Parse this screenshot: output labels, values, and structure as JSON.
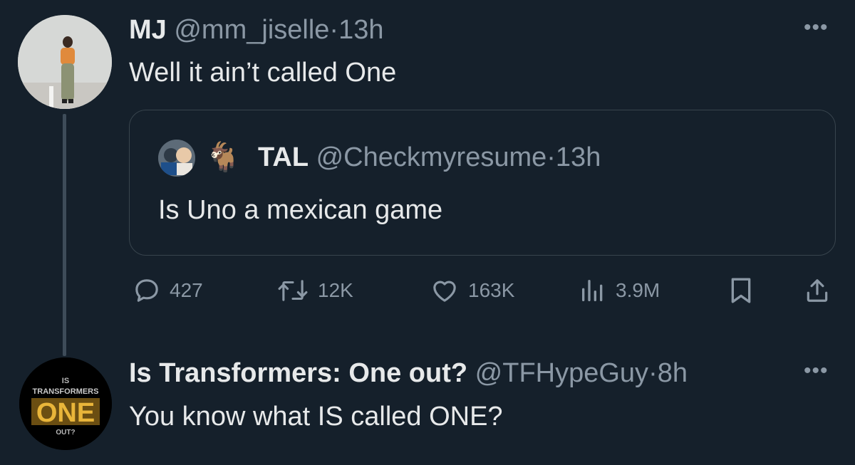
{
  "tweet1": {
    "name": "MJ",
    "handle": "@mm_jiselle",
    "dot": "·",
    "time": "13h",
    "text": "Well it ain’t called One",
    "quote": {
      "emoji": "🐐",
      "name": "TAL",
      "handle": "@Checkmyresume",
      "dot": "·",
      "time": "13h",
      "text": "Is Uno a mexican game"
    },
    "actions": {
      "replies": "427",
      "retweets": "12K",
      "likes": "163K",
      "views": "3.9M"
    }
  },
  "tweet2": {
    "name": "Is Transformers: One out?",
    "handle": "@TFHypeGuy",
    "dot": "·",
    "time": "8h",
    "text": "You know what IS called ONE?",
    "avatar_text": {
      "top": "IS",
      "brand": "TRANSFORMERS",
      "main": "ONE",
      "bottom": "OUT?"
    }
  },
  "more_icon": "more-horizontal-icon",
  "colors": {
    "background": "#15202b",
    "text": "#e7e9ea",
    "muted": "#8b98a5",
    "border": "#38444d"
  }
}
